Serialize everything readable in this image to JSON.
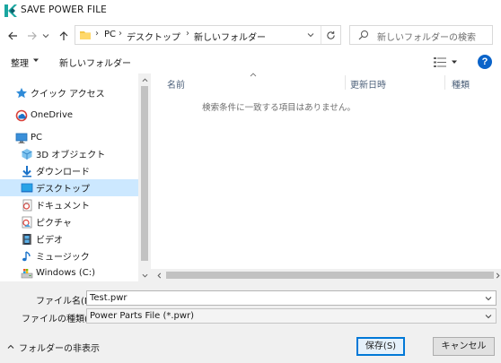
{
  "window": {
    "title": "SAVE POWER FILE",
    "logo_color": "#1aa6a0"
  },
  "nav": {
    "back_icon": "arrow-left-icon",
    "forward_icon": "arrow-right-icon",
    "history_icon": "chevron-down-icon",
    "up_icon": "arrow-up-icon"
  },
  "address": {
    "crumbs": [
      "PC",
      "デスクトップ",
      "新しいフォルダー"
    ],
    "separator": "›"
  },
  "search": {
    "placeholder": "新しいフォルダーの検索"
  },
  "toolbar": {
    "organize_label": "整理",
    "new_folder_label": "新しいフォルダー"
  },
  "sidebar": {
    "items": [
      {
        "label": "クイック アクセス",
        "icon": "star-icon"
      },
      {
        "label": "OneDrive",
        "icon": "onedrive-icon"
      },
      {
        "label": "PC",
        "icon": "pc-icon"
      },
      {
        "label": "3D オブジェクト",
        "icon": "3d-objects-icon"
      },
      {
        "label": "ダウンロード",
        "icon": "download-icon"
      },
      {
        "label": "デスクトップ",
        "icon": "desktop-icon",
        "selected": true
      },
      {
        "label": "ドキュメント",
        "icon": "documents-icon"
      },
      {
        "label": "ピクチャ",
        "icon": "pictures-icon"
      },
      {
        "label": "ビデオ",
        "icon": "videos-icon"
      },
      {
        "label": "ミュージック",
        "icon": "music-icon"
      },
      {
        "label": "Windows (C:)",
        "icon": "drive-icon"
      }
    ]
  },
  "file_list": {
    "columns": [
      "名前",
      "更新日時",
      "種類"
    ],
    "empty_message": "検索条件に一致する項目はありません。"
  },
  "form": {
    "filename_label": "ファイル名(N):",
    "filename_value": "Test.pwr",
    "filetype_label": "ファイルの種類(T):",
    "filetype_value": "Power Parts File (*.pwr)"
  },
  "footer": {
    "hide_folders_label": "フォルダーの非表示",
    "save_label": "保存(S)",
    "cancel_label": "キャンセル"
  },
  "colors": {
    "accent": "#0078d7",
    "selected_bg": "#cce8ff",
    "help_blue": "#0a63c9"
  }
}
